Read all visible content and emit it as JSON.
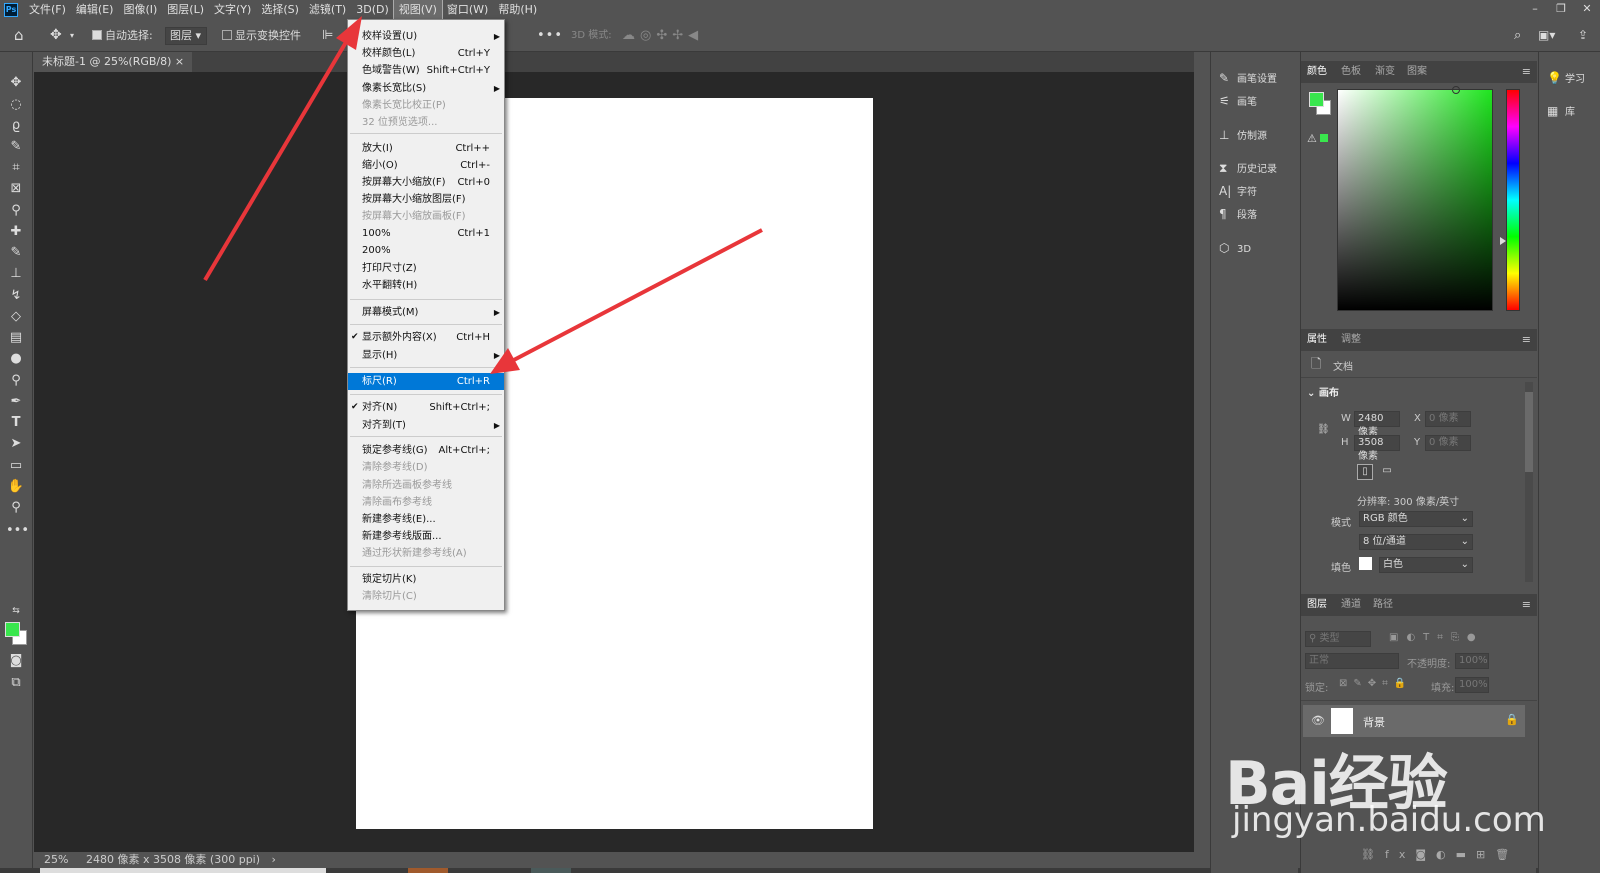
{
  "menubar": {
    "items": [
      "文件(F)",
      "编辑(E)",
      "图像(I)",
      "图层(L)",
      "文字(Y)",
      "选择(S)",
      "滤镜(T)",
      "3D(D)",
      "视图(V)",
      "窗口(W)",
      "帮助(H)"
    ],
    "active_index": 8,
    "logo": "Ps"
  },
  "options": {
    "auto_select_label": "自动选择:",
    "layer_select": "图层",
    "show_transform": "显示变换控件",
    "mode3d": "3D 模式:"
  },
  "tab": {
    "title": "未标题-1 @ 25%(RGB/8)",
    "close": "×"
  },
  "status": {
    "zoom": "25%",
    "info": "2480 像素 x 3508 像素 (300 ppi)"
  },
  "view_menu": {
    "rows": [
      {
        "label": "校样设置(U)",
        "shortcut": "",
        "sub": true
      },
      {
        "label": "校样颜色(L)",
        "shortcut": "Ctrl+Y"
      },
      {
        "label": "色域警告(W)",
        "shortcut": "Shift+Ctrl+Y"
      },
      {
        "label": "像素长宽比(S)",
        "shortcut": "",
        "sub": true
      },
      {
        "label": "像素长宽比校正(P)",
        "shortcut": "",
        "disabled": true
      },
      {
        "label": "32 位预览选项...",
        "shortcut": "",
        "disabled": true
      },
      {
        "label": "放大(I)",
        "shortcut": "Ctrl++"
      },
      {
        "label": "缩小(O)",
        "shortcut": "Ctrl+-"
      },
      {
        "label": "按屏幕大小缩放(F)",
        "shortcut": "Ctrl+0"
      },
      {
        "label": "按屏幕大小缩放图层(F)",
        "shortcut": ""
      },
      {
        "label": "按屏幕大小缩放画板(F)",
        "shortcut": "",
        "disabled": true
      },
      {
        "label": "100%",
        "shortcut": "Ctrl+1"
      },
      {
        "label": "200%",
        "shortcut": ""
      },
      {
        "label": "打印尺寸(Z)",
        "shortcut": ""
      },
      {
        "label": "水平翻转(H)",
        "shortcut": ""
      },
      {
        "label": "屏幕模式(M)",
        "shortcut": "",
        "sub": true
      },
      {
        "label": "显示额外内容(X)",
        "shortcut": "Ctrl+H",
        "checked": true
      },
      {
        "label": "显示(H)",
        "shortcut": "",
        "sub": true
      },
      {
        "label": "标尺(R)",
        "shortcut": "Ctrl+R",
        "highlighted": true
      },
      {
        "label": "对齐(N)",
        "shortcut": "Shift+Ctrl+;",
        "checked": true
      },
      {
        "label": "对齐到(T)",
        "shortcut": "",
        "sub": true
      },
      {
        "label": "锁定参考线(G)",
        "shortcut": "Alt+Ctrl+;"
      },
      {
        "label": "清除参考线(D)",
        "shortcut": "",
        "disabled": true
      },
      {
        "label": "清除所选画板参考线",
        "shortcut": "",
        "disabled": true
      },
      {
        "label": "清除画布参考线",
        "shortcut": "",
        "disabled": true
      },
      {
        "label": "新建参考线(E)...",
        "shortcut": ""
      },
      {
        "label": "新建参考线版面...",
        "shortcut": ""
      },
      {
        "label": "通过形状新建参考线(A)",
        "shortcut": "",
        "disabled": true
      },
      {
        "label": "锁定切片(K)",
        "shortcut": ""
      },
      {
        "label": "清除切片(C)",
        "shortcut": "",
        "disabled": true
      }
    ]
  },
  "collapsed_panels": [
    {
      "icon": "brush-settings-icon",
      "label": "画笔设置"
    },
    {
      "icon": "brush-icon",
      "label": "画笔"
    },
    {
      "icon": "clone-source-icon",
      "label": "仿制源"
    },
    {
      "icon": "history-icon",
      "label": "历史记录"
    },
    {
      "icon": "character-icon",
      "label": "字符"
    },
    {
      "icon": "paragraph-icon",
      "label": "段落"
    },
    {
      "icon": "cube-icon",
      "label": "3D"
    }
  ],
  "color_panel": {
    "tabs": [
      "颜色",
      "色板",
      "渐变",
      "图案"
    ],
    "fg": "#39e64d",
    "bg": "#ffffff"
  },
  "properties": {
    "tabs": [
      "属性",
      "调整"
    ],
    "doc_label": "文档",
    "section": "画布",
    "w_label": "W",
    "w": "2480 像素",
    "h_label": "H",
    "h": "3508 像素",
    "x_label": "X",
    "x": "0 像素",
    "y_label": "Y",
    "y": "0 像素",
    "resolution": "分辨率: 300 像素/英寸",
    "mode_label": "模式",
    "mode": "RGB 颜色",
    "depth": "8 位/通道",
    "fill_label": "填色",
    "fill": "白色"
  },
  "layers": {
    "tabs": [
      "图层",
      "通道",
      "路径"
    ],
    "search": "类型",
    "blend": "正常",
    "opacity_label": "不透明度:",
    "opacity": "100%",
    "lock_label": "锁定:",
    "fill_label": "填充:",
    "fill": "100%",
    "layer_name": "背景"
  },
  "far_right": [
    {
      "icon": "bulb-icon",
      "label": "学习"
    },
    {
      "icon": "library-icon",
      "label": "库"
    }
  ],
  "watermark": {
    "line1": "Bai经验",
    "line2": "jingyan.baidu.com"
  },
  "colors": {
    "accent": "#0078d7",
    "arrow": "#e8363a"
  }
}
